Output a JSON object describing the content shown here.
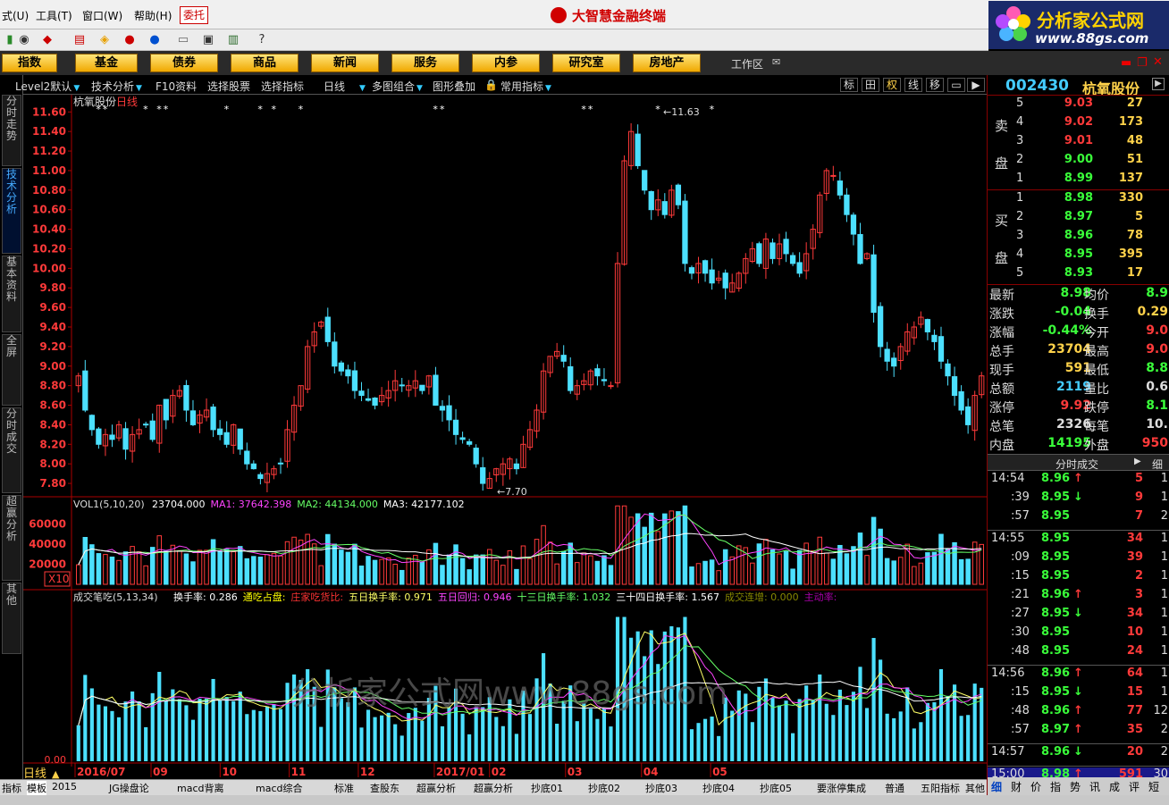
{
  "menubar": {
    "items": [
      "式(U)",
      "工具(T)",
      "窗口(W)",
      "帮助(H)"
    ],
    "weituo": "委托",
    "app_title": "大智慧金融终端"
  },
  "logo": {
    "line1": "分析家公式网",
    "line2": "www.88gs.com"
  },
  "nav": {
    "buttons": [
      "指数",
      "基金",
      "债券",
      "商品",
      "新闻",
      "服务",
      "内参",
      "研究室",
      "房地产"
    ],
    "workarea": "工作区"
  },
  "vtabs": [
    "分时走势",
    "技术分析",
    "基本资料",
    "全屏",
    "分时成交",
    "超赢分析",
    "其他"
  ],
  "chart_toolbar": {
    "items": [
      "Level2默认",
      "技术分析",
      "F10资料",
      "选择股票",
      "选择指标",
      "日线",
      "多图组合",
      "图形叠加",
      "常用指标"
    ],
    "right": [
      "标",
      "田",
      "权",
      "线",
      "移"
    ]
  },
  "chart": {
    "title": "杭氧股份",
    "period": "日线",
    "high_label": "11.63",
    "low_label": "7.70",
    "vol_title": "VOL1(5,10,20)",
    "vol_values": [
      {
        "text": "23704.000",
        "color": "#ffffff"
      },
      {
        "text": "MA1: 37642.398",
        "color": "#ff44ff"
      },
      {
        "text": "MA2: 44134.000",
        "color": "#66ff66"
      },
      {
        "text": "MA3: 42177.102",
        "color": "#ffffff"
      }
    ],
    "vol_unit": "X10",
    "ind_title": "成交笔吃(5,13,34)",
    "ind_values": [
      {
        "text": "换手率: 0.286",
        "color": "#ffffff"
      },
      {
        "text": "通吃占盘:",
        "color": "#ffff00"
      },
      {
        "text": "庄家吃货比:",
        "color": "#ff3333"
      },
      {
        "text": "五日换手率: 0.971",
        "color": "#ffff66"
      },
      {
        "text": "五日回归: 0.946",
        "color": "#ff44ff"
      },
      {
        "text": "十三日换手率: 1.032",
        "color": "#66ff66"
      },
      {
        "text": "三十四日换手率: 1.567",
        "color": "#ffffff"
      },
      {
        "text": "成交连增: 0.000",
        "color": "#888800"
      },
      {
        "text": "主动率:",
        "color": "#aa00aa"
      }
    ],
    "ind_zero": "0.00",
    "watermark": "分析家公式网www.88gs.com",
    "period_label": "日线"
  },
  "chart_data": {
    "type": "candlestick",
    "price_ticks": [
      "11.60",
      "11.40",
      "11.20",
      "11.00",
      "10.80",
      "10.60",
      "10.40",
      "10.20",
      "10.00",
      "9.80",
      "9.60",
      "9.40",
      "9.20",
      "9.00",
      "8.80",
      "8.60",
      "8.40",
      "8.20",
      "8.00",
      "7.80"
    ],
    "vol_ticks": [
      "60000",
      "40000",
      "20000"
    ],
    "x_labels": [
      "2016/07",
      "09",
      "10",
      "11",
      "12",
      "2017/01",
      "02",
      "03",
      "04",
      "05"
    ],
    "ylim": [
      7.7,
      11.63
    ],
    "close": [
      8.9,
      8.55,
      8.35,
      8.2,
      8.3,
      8.25,
      8.4,
      8.15,
      8.3,
      8.35,
      8.4,
      8.25,
      8.6,
      8.45,
      8.7,
      8.75,
      8.55,
      8.4,
      8.5,
      8.55,
      8.35,
      8.3,
      8.2,
      8.4,
      8.15,
      8.0,
      7.95,
      7.85,
      7.9,
      7.95,
      8.0,
      8.35,
      8.6,
      8.8,
      9.2,
      9.35,
      9.45,
      9.25,
      9.0,
      8.95,
      8.9,
      8.75,
      8.7,
      8.65,
      8.6,
      8.7,
      8.75,
      8.85,
      8.8,
      8.8,
      8.85,
      8.75,
      8.9,
      8.6,
      8.55,
      8.45,
      8.3,
      8.25,
      8.2,
      8.0,
      7.8,
      7.85,
      7.95,
      8.0,
      8.05,
      7.95,
      8.2,
      8.35,
      8.55,
      8.95,
      9.1,
      9.15,
      9.05,
      8.75,
      8.8,
      8.85,
      8.95,
      8.9,
      8.85,
      8.8,
      10.05,
      11.1,
      11.4,
      11.05,
      10.8,
      10.6,
      10.7,
      10.55,
      10.8,
      10.65,
      10.05,
      9.95,
      10.05,
      9.95,
      9.85,
      9.9,
      9.8,
      9.85,
      9.95,
      10.1,
      10.2,
      10.05,
      10.3,
      10.1,
      10.25,
      10.15,
      10.05,
      9.95,
      10.15,
      10.4,
      10.75,
      11.0,
      10.95,
      10.75,
      10.55,
      10.35,
      10.05,
      10.15,
      9.55,
      9.2,
      9.05,
      9.0,
      9.2,
      9.35,
      9.4,
      9.5,
      9.35,
      9.25,
      9.05,
      8.9,
      8.7,
      8.55,
      8.4,
      8.7,
      8.9
    ]
  },
  "quote": {
    "code": "002430",
    "name": "杭氧股份",
    "sell_label": [
      "卖",
      "盘"
    ],
    "buy_label": [
      "买",
      "盘"
    ],
    "sell": [
      {
        "lv": "5",
        "price": "9.03",
        "vol": "27",
        "color": "#ff3a3a"
      },
      {
        "lv": "4",
        "price": "9.02",
        "vol": "173",
        "color": "#ff3a3a"
      },
      {
        "lv": "3",
        "price": "9.01",
        "vol": "48",
        "color": "#ff3a3a"
      },
      {
        "lv": "2",
        "price": "9.00",
        "vol": "51",
        "color": "#3aff3a"
      },
      {
        "lv": "1",
        "price": "8.99",
        "vol": "137",
        "color": "#3aff3a"
      }
    ],
    "buy": [
      {
        "lv": "1",
        "price": "8.98",
        "vol": "330",
        "color": "#3aff3a"
      },
      {
        "lv": "2",
        "price": "8.97",
        "vol": "5",
        "color": "#3aff3a"
      },
      {
        "lv": "3",
        "price": "8.96",
        "vol": "78",
        "color": "#3aff3a"
      },
      {
        "lv": "4",
        "price": "8.95",
        "vol": "395",
        "color": "#3aff3a"
      },
      {
        "lv": "5",
        "price": "8.93",
        "vol": "17",
        "color": "#3aff3a"
      }
    ],
    "stats": [
      {
        "k": "最新",
        "v": "8.98",
        "vc": "#3aff3a",
        "k2": "均价",
        "v2": "8.9",
        "v2c": "#3aff3a"
      },
      {
        "k": "涨跌",
        "v": "-0.04",
        "vc": "#3aff3a",
        "k2": "换手",
        "v2": "0.29",
        "v2c": "#ffd24a"
      },
      {
        "k": "涨幅",
        "v": "-0.44%",
        "vc": "#3aff3a",
        "k2": "今开",
        "v2": "9.0",
        "v2c": "#ff3a3a"
      },
      {
        "k": "总手",
        "v": "23704",
        "vc": "#ffd24a",
        "k2": "最高",
        "v2": "9.0",
        "v2c": "#ff3a3a"
      },
      {
        "k": "现手",
        "v": "591",
        "vc": "#ffd24a",
        "k2": "最低",
        "v2": "8.8",
        "v2c": "#3aff3a"
      },
      {
        "k": "总额",
        "v": "2119",
        "vc": "#4cf",
        "k2": "量比",
        "v2": "0.6",
        "v2c": "#ddd"
      },
      {
        "k": "涨停",
        "v": "9.92",
        "vc": "#ff3a3a",
        "k2": "跌停",
        "v2": "8.1",
        "v2c": "#3aff3a"
      },
      {
        "k": "总笔",
        "v": "2326",
        "vc": "#ddd",
        "k2": "每笔",
        "v2": "10.",
        "v2c": "#ddd"
      },
      {
        "k": "内盘",
        "v": "14195",
        "vc": "#3aff3a",
        "k2": "外盘",
        "v2": "950",
        "v2c": "#ff3a3a"
      }
    ],
    "fs_title": "分时成交",
    "fs_right": "细",
    "ticks": [
      {
        "t": "14:54",
        "p": "8.96",
        "d": "↑",
        "pc": "#3aff3a",
        "ac": "#ff3a3a",
        "v": "5",
        "vc": "#ff3a3a",
        "n": "1",
        "sep": false
      },
      {
        "t": ":39",
        "p": "8.95",
        "d": "↓",
        "pc": "#3aff3a",
        "ac": "#3aff3a",
        "v": "9",
        "vc": "#ff3a3a",
        "n": "1",
        "sep": false
      },
      {
        "t": ":57",
        "p": "8.95",
        "d": "",
        "pc": "#3aff3a",
        "ac": "#3aff3a",
        "v": "7",
        "vc": "#ff3a3a",
        "n": "2",
        "sep": false
      },
      {
        "t": "14:55",
        "p": "8.95",
        "d": "",
        "pc": "#3aff3a",
        "ac": "#3aff3a",
        "v": "34",
        "vc": "#ff3a3a",
        "n": "1",
        "sep": true
      },
      {
        "t": ":09",
        "p": "8.95",
        "d": "",
        "pc": "#3aff3a",
        "ac": "#3aff3a",
        "v": "39",
        "vc": "#ff3a3a",
        "n": "1",
        "sep": false
      },
      {
        "t": ":15",
        "p": "8.95",
        "d": "",
        "pc": "#3aff3a",
        "ac": "#3aff3a",
        "v": "2",
        "vc": "#ff3a3a",
        "n": "1",
        "sep": false
      },
      {
        "t": ":21",
        "p": "8.96",
        "d": "↑",
        "pc": "#3aff3a",
        "ac": "#ff3a3a",
        "v": "3",
        "vc": "#ff3a3a",
        "n": "1",
        "sep": false
      },
      {
        "t": ":27",
        "p": "8.95",
        "d": "↓",
        "pc": "#3aff3a",
        "ac": "#3aff3a",
        "v": "34",
        "vc": "#ff3a3a",
        "n": "1",
        "sep": false
      },
      {
        "t": ":30",
        "p": "8.95",
        "d": "",
        "pc": "#3aff3a",
        "ac": "#3aff3a",
        "v": "10",
        "vc": "#ff3a3a",
        "n": "1",
        "sep": false
      },
      {
        "t": ":48",
        "p": "8.95",
        "d": "",
        "pc": "#3aff3a",
        "ac": "#3aff3a",
        "v": "24",
        "vc": "#ff3a3a",
        "n": "1",
        "sep": false
      },
      {
        "t": "14:56",
        "p": "8.96",
        "d": "↑",
        "pc": "#3aff3a",
        "ac": "#ff3a3a",
        "v": "64",
        "vc": "#ff3a3a",
        "n": "1",
        "sep": true
      },
      {
        "t": ":15",
        "p": "8.95",
        "d": "↓",
        "pc": "#3aff3a",
        "ac": "#3aff3a",
        "v": "15",
        "vc": "#ff3a3a",
        "n": "1",
        "sep": false
      },
      {
        "t": ":48",
        "p": "8.96",
        "d": "↑",
        "pc": "#3aff3a",
        "ac": "#ff3a3a",
        "v": "77",
        "vc": "#ff3a3a",
        "n": "12",
        "sep": false
      },
      {
        "t": ":57",
        "p": "8.97",
        "d": "↑",
        "pc": "#3aff3a",
        "ac": "#ff3a3a",
        "v": "35",
        "vc": "#ff3a3a",
        "n": "2",
        "sep": false
      },
      {
        "t": "14:57",
        "p": "8.96",
        "d": "↓",
        "pc": "#3aff3a",
        "ac": "#3aff3a",
        "v": "20",
        "vc": "#ff3a3a",
        "n": "2",
        "sep": true
      },
      {
        "t": "15:00",
        "p": "8.98",
        "d": "↑",
        "pc": "#3aff3a",
        "ac": "#ff3a3a",
        "v": "591",
        "vc": "#ff3a3a",
        "n": "30",
        "sep": true,
        "hl": true
      }
    ],
    "rtabs": [
      "细",
      "财",
      "价",
      "指",
      "势",
      "讯",
      "成",
      "评",
      "短"
    ]
  },
  "bottom_tabs": [
    "指标",
    "模板",
    "2015",
    "JG操盘论",
    "macd背离",
    "macd综合",
    "标准",
    "查股东",
    "超赢分析",
    "超赢分析",
    "抄底01",
    "抄底02",
    "抄底03",
    "抄底04",
    "抄底05",
    "要涨停集成",
    "普通",
    "五阳指标",
    "其他"
  ]
}
